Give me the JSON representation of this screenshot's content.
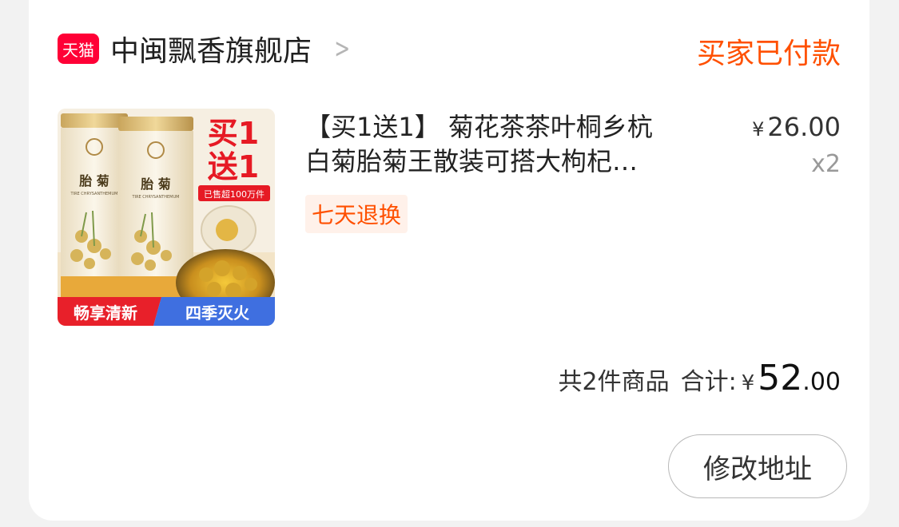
{
  "store": {
    "badge": "天猫",
    "name": "中闽飘香旗舰店",
    "status": "买家已付款"
  },
  "product": {
    "image": {
      "promo_main": "买1送1",
      "sold_badge": "已售超100万件",
      "jar_label": "胎菊",
      "jar_sub": "TIRE CHRYSANTHEMUM",
      "tagline_left": "畅享清新",
      "tagline_right": "四季灭火"
    },
    "title_line1": "【买1送1】 菊花茶茶叶桐乡杭",
    "title_line2": "白菊胎菊王散装可搭大枸杞…",
    "price_symbol": "¥",
    "price": "26.00",
    "qty": "x2",
    "tag": "七天退换"
  },
  "summary": {
    "count_text": "共2件商品",
    "total_label": "合计:",
    "currency": "¥",
    "total_int": "52",
    "total_dec": ".00"
  },
  "actions": {
    "modify_address": "修改地址"
  },
  "colors": {
    "accent": "#ff5000",
    "tmall_red": "#ff0036"
  }
}
